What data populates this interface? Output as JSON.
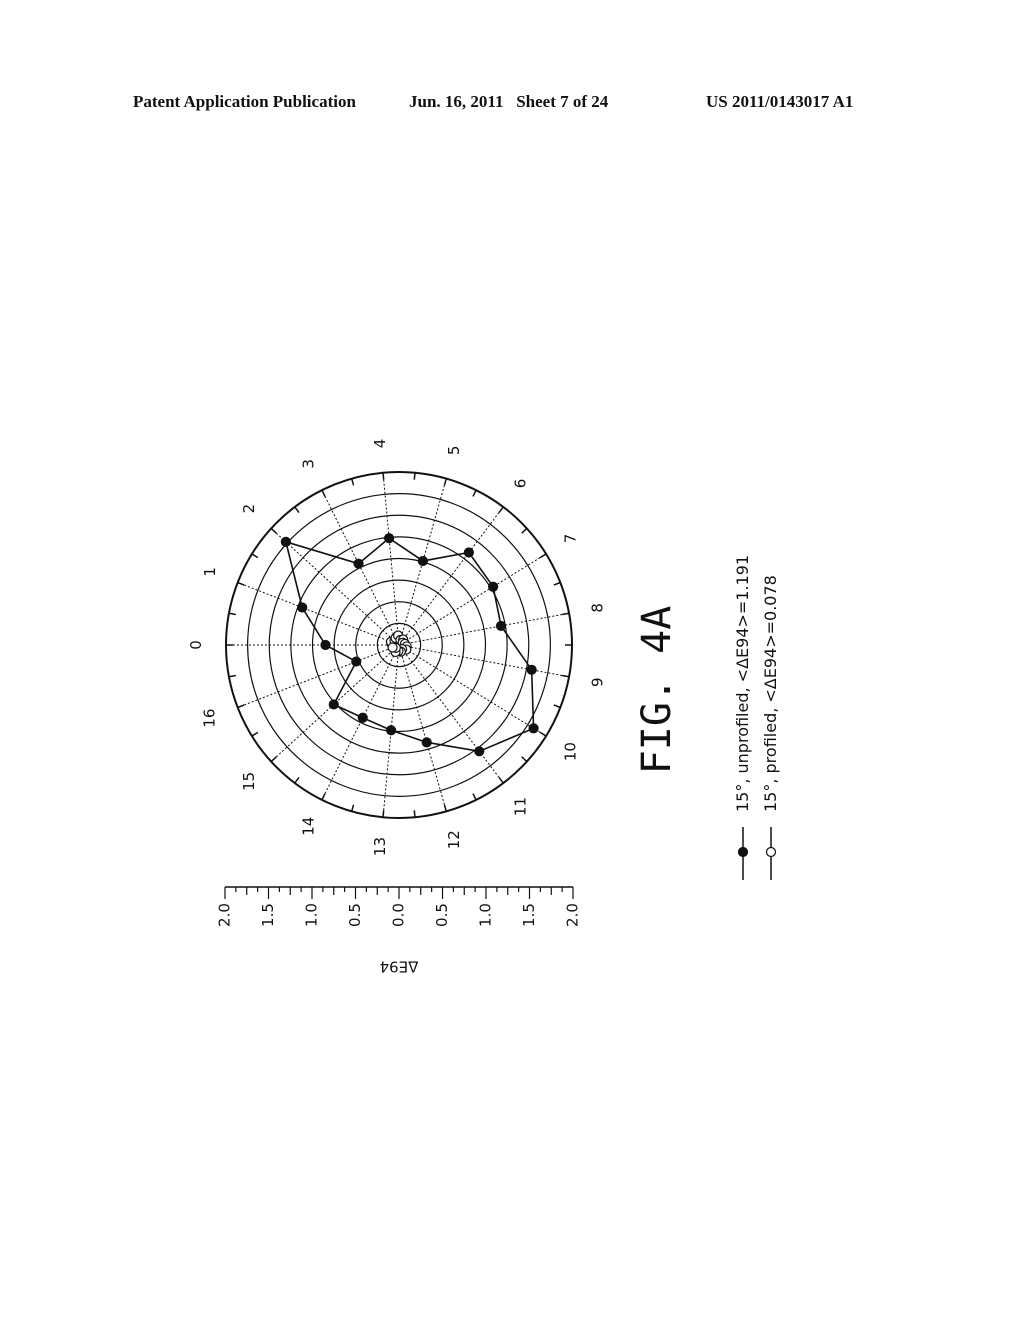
{
  "header": {
    "left": "Patent Application Publication",
    "middle": "Jun. 16, 2011   Sheet 7 of 24",
    "right": "US 2011/0143017 A1"
  },
  "figure": {
    "label": "FIG. 4A",
    "rotation": "90° counter-clockwise"
  },
  "chart_data": {
    "type": "polar",
    "title": "",
    "angular_labels": [
      "0",
      "1",
      "2",
      "3",
      "4",
      "5",
      "6",
      "7",
      "8",
      "9",
      "10",
      "11",
      "12",
      "13",
      "14",
      "15",
      "16"
    ],
    "radial_axis": {
      "label": "ΔE94",
      "ticks": [
        "2.0",
        "1.5",
        "1.0",
        "0.5",
        "0.0",
        "0.5",
        "1.0",
        "1.5",
        "2.0"
      ],
      "range": [
        0,
        2.0
      ],
      "ring_step": 0.25
    },
    "grid": true,
    "legend_position": "bottom",
    "series": [
      {
        "name": "15°, unprofiled, <ΔE94>=1.191",
        "marker": "filled-circle",
        "values": [
          0.85,
          1.2,
          1.77,
          1.05,
          1.24,
          1.01,
          1.34,
          1.28,
          1.2,
          1.56,
          1.83,
          1.54,
          1.17,
          0.99,
          0.94,
          1.02,
          0.53
        ]
      },
      {
        "name": "15°, profiled, <ΔE94>=0.078",
        "marker": "open-circle",
        "values": [
          0.08,
          0.1,
          0.07,
          0.09,
          0.11,
          0.06,
          0.08,
          0.05,
          0.07,
          0.09,
          0.1,
          0.06,
          0.08,
          0.07,
          0.09,
          0.05,
          0.08
        ]
      }
    ]
  }
}
